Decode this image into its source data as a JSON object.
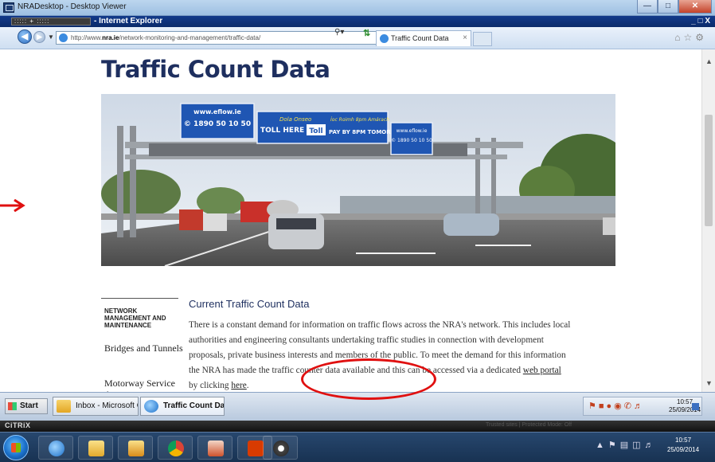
{
  "outer_window": {
    "title": "NRADesktop - Desktop Viewer"
  },
  "ie_window": {
    "title": "- Internet Explorer",
    "ctx_box": "::::: + :::::"
  },
  "navbar": {
    "url_prefix": "http://www.",
    "url_domain": "nra.ie",
    "url_path": "/network-monitoring-and-management/traffic-data/",
    "tab_label": "Traffic Count Data"
  },
  "page": {
    "title": "Traffic Count Data",
    "hero_alt": "motorway gantry photo",
    "sign_texts": {
      "left_top": "www.eflow.ie",
      "left_phone": "© 1890 50 10 50",
      "center_line1": "Dola Onseo",
      "center_line2": "TOLL HERE",
      "toll_badge": "Toll",
      "center_line3": "Íoc Roimh 8pm Amárach",
      "center_line4": "PAY BY 8PM TOMORROW",
      "right_top": "www.eflow.ie",
      "right_phone": "© 1890 50 10 50"
    },
    "sidebar": {
      "heading": "NETWORK MANAGEMENT AND MAINTENANCE",
      "items": [
        {
          "label": "Bridges and Tunnels"
        },
        {
          "label": "Motorway Service Areas"
        }
      ]
    },
    "section_title": "Current Traffic Count Data",
    "body_text_1": "There is a constant demand for information on traffic flows across the NRA's network. This includes local authorities and engineering consultants undertaking traffic studies in connection with development proposals, private business interests and members of the public. To meet the demand for this information the NRA has made the traffic counter data available and this can be accessed via a dedicated ",
    "link_web_portal": "web portal",
    "body_text_2": " by clicking ",
    "link_here": "here",
    "body_text_3": "."
  },
  "inner_taskbar": {
    "start_label": "Start",
    "items": [
      {
        "label": "Inbox - Microsoft Out..."
      },
      {
        "label": "Traffic Count Data ..."
      }
    ],
    "time": "10:57",
    "date": "25/09/2014"
  },
  "citrix": {
    "logo": "CiTRiX",
    "status": "Trusted sites | Protected Mode: Off"
  },
  "outer_taskbar": {
    "time": "10:57",
    "date": "25/09/2014"
  },
  "colors": {
    "title_navy": "#1e2f5f",
    "sign_blue": "#1f56b3",
    "annotation_red": "#e01010"
  }
}
